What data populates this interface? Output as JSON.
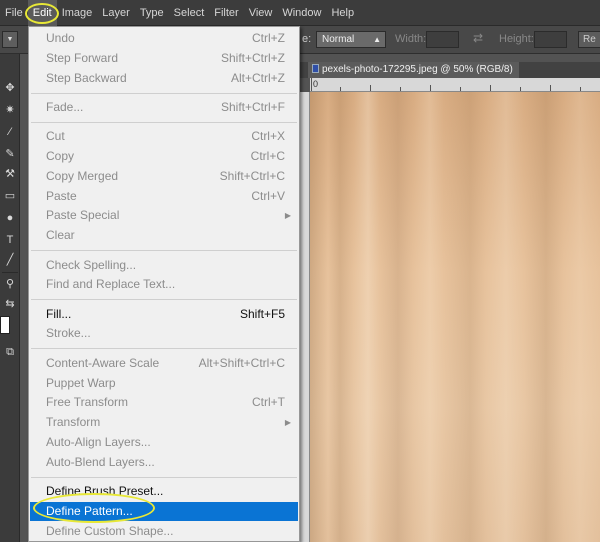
{
  "menubar": {
    "items": [
      "File",
      "Edit",
      "Image",
      "Layer",
      "Type",
      "Select",
      "Filter",
      "View",
      "Window",
      "Help"
    ],
    "active": "Edit"
  },
  "options_bar": {
    "style_label": "e:",
    "style_value": "Normal",
    "width_label": "Width:",
    "height_label": "Height:",
    "refine_label": "Re"
  },
  "document": {
    "tab_title": "pexels-photo-172295.jpeg @ 50% (RGB/8)",
    "ruler_origin": "0",
    "zoom": "50%"
  },
  "edit_menu": {
    "groups": [
      [
        {
          "label": "Undo",
          "shortcut": "Ctrl+Z",
          "enabled": false
        },
        {
          "label": "Step Forward",
          "shortcut": "Shift+Ctrl+Z",
          "enabled": false
        },
        {
          "label": "Step Backward",
          "shortcut": "Alt+Ctrl+Z",
          "enabled": false
        }
      ],
      [
        {
          "label": "Fade...",
          "shortcut": "Shift+Ctrl+F",
          "enabled": false
        }
      ],
      [
        {
          "label": "Cut",
          "shortcut": "Ctrl+X",
          "enabled": false
        },
        {
          "label": "Copy",
          "shortcut": "Ctrl+C",
          "enabled": false
        },
        {
          "label": "Copy Merged",
          "shortcut": "Shift+Ctrl+C",
          "enabled": false
        },
        {
          "label": "Paste",
          "shortcut": "Ctrl+V",
          "enabled": false
        },
        {
          "label": "Paste Special",
          "shortcut": "",
          "enabled": false,
          "submenu": true
        },
        {
          "label": "Clear",
          "shortcut": "",
          "enabled": false
        }
      ],
      [
        {
          "label": "Check Spelling...",
          "shortcut": "",
          "enabled": false
        },
        {
          "label": "Find and Replace Text...",
          "shortcut": "",
          "enabled": false
        }
      ],
      [
        {
          "label": "Fill...",
          "shortcut": "Shift+F5",
          "enabled": true
        },
        {
          "label": "Stroke...",
          "shortcut": "",
          "enabled": false
        }
      ],
      [
        {
          "label": "Content-Aware Scale",
          "shortcut": "Alt+Shift+Ctrl+C",
          "enabled": false
        },
        {
          "label": "Puppet Warp",
          "shortcut": "",
          "enabled": false
        },
        {
          "label": "Free Transform",
          "shortcut": "Ctrl+T",
          "enabled": false
        },
        {
          "label": "Transform",
          "shortcut": "",
          "enabled": false,
          "submenu": true
        },
        {
          "label": "Auto-Align Layers...",
          "shortcut": "",
          "enabled": false
        },
        {
          "label": "Auto-Blend Layers...",
          "shortcut": "",
          "enabled": false
        }
      ],
      [
        {
          "label": "Define Brush Preset...",
          "shortcut": "",
          "enabled": true
        },
        {
          "label": "Define Pattern...",
          "shortcut": "",
          "enabled": true,
          "selected": true
        },
        {
          "label": "Define Custom Shape...",
          "shortcut": "",
          "enabled": false
        }
      ]
    ],
    "submenu_arrow": "▶"
  },
  "colors": {
    "menu_selected": "#0a74d4",
    "highlight_ring": "#e8e836",
    "menu_bg": "#f0f0f0"
  }
}
